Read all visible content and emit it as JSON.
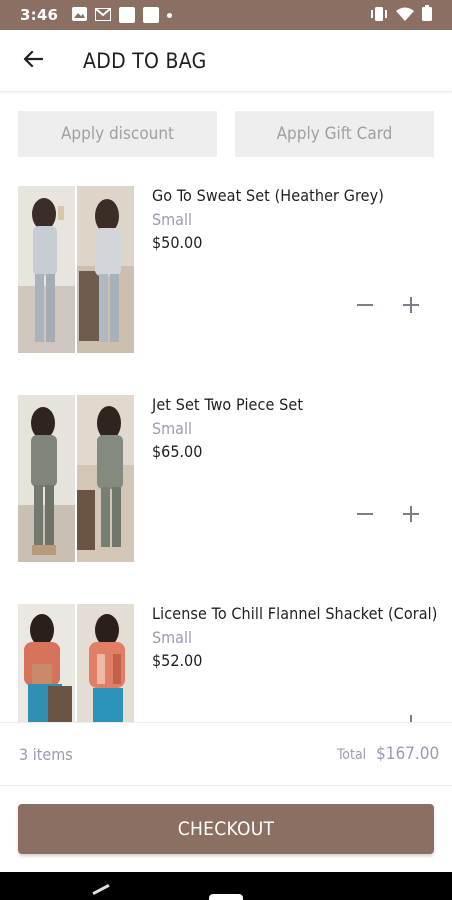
{
  "status_bar": {
    "time": "3:46",
    "bg_color": "#8b6f62"
  },
  "header": {
    "title": "ADD TO BAG",
    "back_icon": "arrow-left-icon"
  },
  "actions": {
    "discount_label": "Apply discount",
    "gift_card_label": "Apply Gift Card"
  },
  "items": [
    {
      "name": "Go To Sweat Set (Heather Grey)",
      "size": "Small",
      "price": "$50.00",
      "photo_palette": [
        "#e9e6e1",
        "#a9b3bc",
        "#6e5b4d"
      ]
    },
    {
      "name": "Jet Set Two Piece Set",
      "size": "Small",
      "price": "$65.00",
      "photo_palette": [
        "#e4e2dd",
        "#7f8578",
        "#6b5444"
      ]
    },
    {
      "name": "License To Chill Flannel Shacket (Coral)",
      "size": "Small",
      "price": "$52.00",
      "photo_palette": [
        "#ece9e4",
        "#d7735b",
        "#2f8fb4"
      ]
    }
  ],
  "summary": {
    "item_count": "3 items",
    "total_label": "Total",
    "total_value": "$167.00"
  },
  "checkout": {
    "label": "CHECKOUT",
    "bg_color": "#8b6f62"
  }
}
